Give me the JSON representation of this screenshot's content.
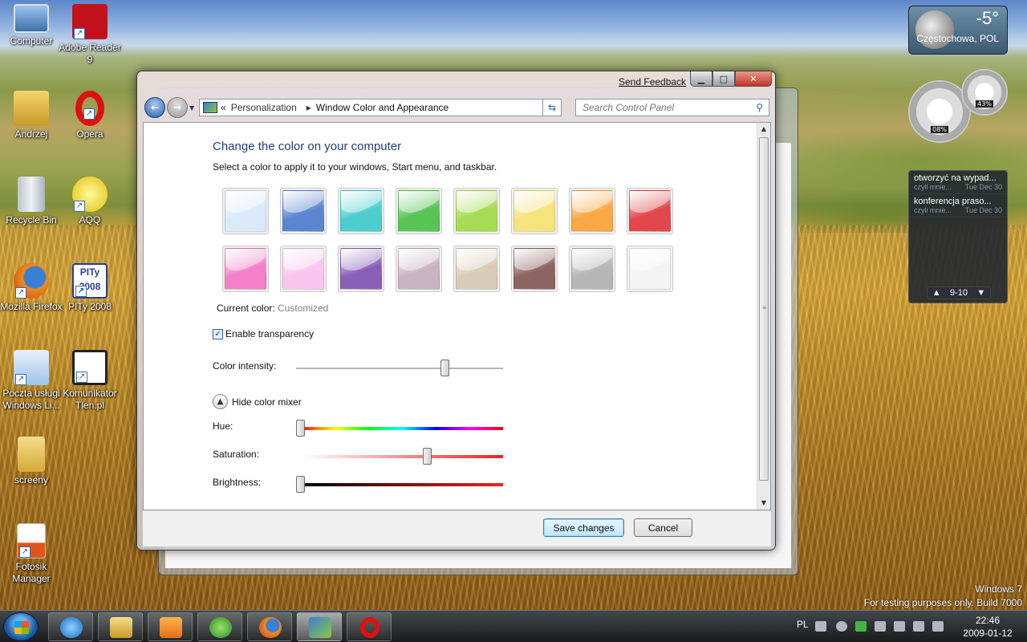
{
  "desktop": {
    "icons": [
      {
        "label": "Computer",
        "icon": "computer-icon"
      },
      {
        "label": "Adobe Reader 9",
        "icon": "adobe-reader-icon"
      },
      {
        "label": "Andrzej",
        "icon": "user-folder-icon"
      },
      {
        "label": "Opera",
        "icon": "opera-icon"
      },
      {
        "label": "Recycle Bin",
        "icon": "recycle-bin-icon"
      },
      {
        "label": "AQQ",
        "icon": "aqq-icon"
      },
      {
        "label": "Mozilla Firefox",
        "icon": "firefox-icon"
      },
      {
        "label": "PITy 2008",
        "icon": "pity-icon"
      },
      {
        "label": "Poczta usługi Windows Li...",
        "icon": "windows-live-mail-icon"
      },
      {
        "label": "Komunikator Tlen.pl",
        "icon": "tlen-icon"
      },
      {
        "label": "screeny",
        "icon": "folder-icon"
      },
      {
        "label": "Fotosik Manager",
        "icon": "fotosik-icon"
      }
    ],
    "icon_text": {
      "pity": "PITy 2008"
    },
    "watermark": {
      "line1": "Windows 7",
      "line2": "For testing purposes only. Build 7000"
    }
  },
  "gadgets": {
    "weather": {
      "temp": "-5°",
      "city": "Częstochowa, POL"
    },
    "meters": {
      "cpu": "08%",
      "memory": "43%"
    },
    "feed": {
      "items": [
        {
          "title": "otworzyć na wypad...",
          "source": "czyli mnie...",
          "date": "Tue Dec 30"
        },
        {
          "title": "konferencja praso...",
          "source": "czyli mnie...",
          "date": "Tue Dec 30"
        }
      ],
      "pager": "9-10"
    }
  },
  "window": {
    "send_feedback": "Send Feedback",
    "breadcrumb": {
      "root_chevron": "«",
      "crumb1": "Personalization",
      "crumb2": "Window Color and Appearance"
    },
    "search_placeholder": "Search Control Panel",
    "title": "Change the color on your computer",
    "subtitle": "Select a color to apply it to your windows, Start menu, and taskbar.",
    "swatches": [
      {
        "name": "sky",
        "color": "#dbe9fb"
      },
      {
        "name": "twilight",
        "color": "#5b86cf"
      },
      {
        "name": "sea",
        "color": "#4ccfcc"
      },
      {
        "name": "leaf",
        "color": "#58c454"
      },
      {
        "name": "lime",
        "color": "#a6dc54"
      },
      {
        "name": "lemon",
        "color": "#f5e37c"
      },
      {
        "name": "pumpkin",
        "color": "#f9a845"
      },
      {
        "name": "blush",
        "color": "#e2474b"
      },
      {
        "name": "violet",
        "color": "#f380c8"
      },
      {
        "name": "lavender",
        "color": "#f8c6f0"
      },
      {
        "name": "taupe",
        "color": "#8a5fb8"
      },
      {
        "name": "chocolate",
        "color": "#c9b3c1"
      },
      {
        "name": "slate",
        "color": "#d8ccb6"
      },
      {
        "name": "frost",
        "color": "#8c6462"
      },
      {
        "name": "silver",
        "color": "#b6b6b6"
      },
      {
        "name": "white",
        "color": "#f4f4f4"
      }
    ],
    "current_color_label": "Current color:",
    "current_color_value": "Customized",
    "transparency_label": "Enable transparency",
    "transparency_checked": true,
    "intensity_label": "Color intensity:",
    "intensity_level": 0.73,
    "mixer_toggle_label": "Hide color mixer",
    "hue_label": "Hue:",
    "hue_level": 0.0,
    "saturation_label": "Saturation:",
    "saturation_level": 0.64,
    "brightness_label": "Brightness:",
    "brightness_level": 0.0,
    "save_label": "Save changes",
    "cancel_label": "Cancel"
  },
  "taskbar": {
    "language": "PL",
    "time": "22:46",
    "date": "2009-01-12",
    "apps": [
      "explorer-icon",
      "internet-explorer-icon",
      "libraries-icon",
      "media-player-icon",
      "messenger-icon",
      "firefox-icon",
      "control-panel-icon",
      "opera-icon"
    ]
  }
}
